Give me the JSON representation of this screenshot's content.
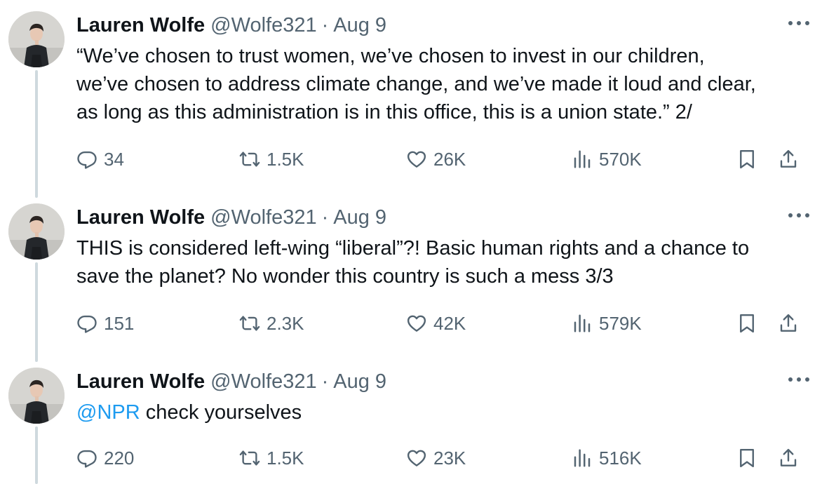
{
  "tweets": [
    {
      "name": "Lauren Wolfe",
      "handle": "@Wolfe321",
      "separator": "·",
      "date": "Aug 9",
      "text": "“We’ve chosen to trust women, we’ve chosen to invest in our children,\nwe’ve chosen to address climate change, and we’ve made it loud and clear,\nas long as this administration is in this office, this is a union state.” 2/",
      "mention": "",
      "replies": "34",
      "retweets": "1.5K",
      "likes": "26K",
      "views": "570K"
    },
    {
      "name": "Lauren Wolfe",
      "handle": "@Wolfe321",
      "separator": "·",
      "date": "Aug 9",
      "text": "THIS is considered left-wing “liberal”?! Basic human rights and a chance to\nsave the planet? No wonder this country is such a mess 3/3",
      "mention": "",
      "replies": "151",
      "retweets": "2.3K",
      "likes": "42K",
      "views": "579K"
    },
    {
      "name": "Lauren Wolfe",
      "handle": "@Wolfe321",
      "separator": "·",
      "date": "Aug 9",
      "text": " check yourselves",
      "mention": "@NPR",
      "replies": "220",
      "retweets": "1.5K",
      "likes": "23K",
      "views": "516K"
    }
  ],
  "icons": {
    "reply": "reply-icon",
    "retweet": "retweet-icon",
    "like": "like-icon",
    "views": "views-icon",
    "bookmark": "bookmark-icon",
    "share": "share-icon",
    "more": "more-icon"
  },
  "colors": {
    "text": "#0f1419",
    "secondary": "#536471",
    "link": "#1d9bf0",
    "thread_line": "#cfd9de"
  }
}
